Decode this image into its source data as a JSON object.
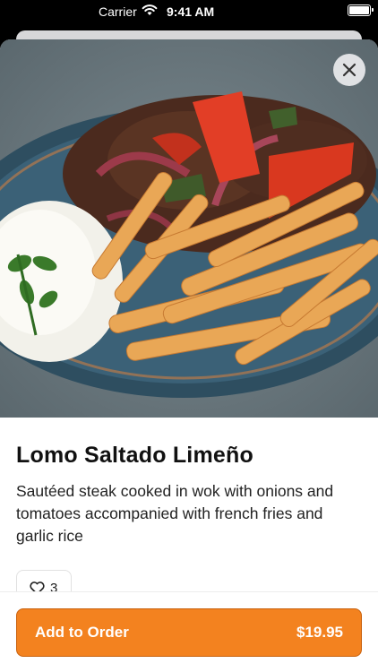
{
  "status_bar": {
    "carrier": "Carrier",
    "time": "9:41 AM"
  },
  "product": {
    "name": "Lomo Saltado Limeño",
    "description": "Sautéed steak cooked in wok with onions and tomatoes accompanied with french fries and garlic rice",
    "likes": "3"
  },
  "order": {
    "button_label": "Add to Order",
    "price": "$19.95"
  },
  "icons": {
    "close": "close-icon",
    "like": "heart-outline-icon",
    "wifi": "wifi-icon",
    "battery": "battery-icon"
  },
  "colors": {
    "accent": "#f3821f",
    "accent_border": "#c9620e"
  }
}
